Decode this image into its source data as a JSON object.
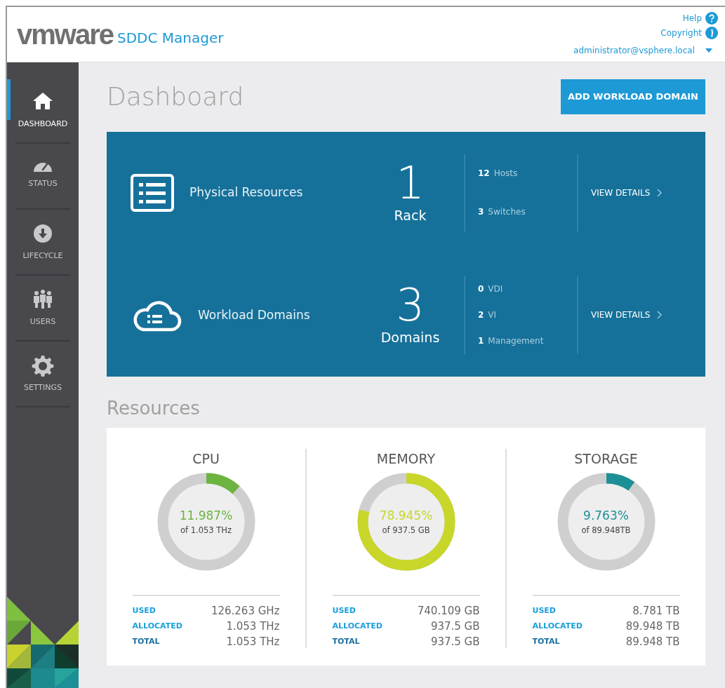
{
  "header": {
    "logo": "vmware",
    "product": "SDDC Manager",
    "links": [
      {
        "label": "Help",
        "kind": "help"
      },
      {
        "label": "Copyright",
        "kind": "info"
      }
    ],
    "user": "administrator@vsphere.local"
  },
  "sidebar": {
    "items": [
      {
        "label": "DASHBOARD",
        "kind": "home",
        "selected": true
      },
      {
        "label": "STATUS",
        "kind": "gauge",
        "selected": false
      },
      {
        "label": "LIFECYCLE",
        "kind": "download",
        "selected": false
      },
      {
        "label": "USERS",
        "kind": "users",
        "selected": false
      },
      {
        "label": "SETTINGS",
        "kind": "gear",
        "selected": false
      }
    ]
  },
  "page": {
    "title": "Dashboard",
    "action": "ADD WORKLOAD DOMAIN"
  },
  "summary": [
    {
      "kind": "list",
      "title": "Physical Resources",
      "count": "1",
      "unit": "Rack",
      "stats": [
        {
          "count": "12",
          "label": "Hosts"
        },
        {
          "count": "3",
          "label": "Switches"
        }
      ],
      "link": "VIEW DETAILS"
    },
    {
      "kind": "cloud",
      "title": "Workload Domains",
      "count": "3",
      "unit": "Domains",
      "stats": [
        {
          "count": "0",
          "label": "VDI"
        },
        {
          "count": "2",
          "label": "VI"
        },
        {
          "count": "1",
          "label": "Management"
        }
      ],
      "link": "VIEW DETAILS"
    }
  ],
  "resources": {
    "title": "Resources",
    "items": [
      {
        "name": "CPU",
        "percent": "11.987%",
        "of": "of 1.053 THz",
        "color": "#6db33f",
        "rows": [
          {
            "label": "USED",
            "value": "126.263 GHz"
          },
          {
            "label": "ALLOCATED",
            "value": "1.053 THz"
          },
          {
            "label": "TOTAL",
            "value": "1.053 THz"
          }
        ]
      },
      {
        "name": "MEMORY",
        "percent": "78.945%",
        "of": "of 937.5 GB",
        "color": "#c8d62a",
        "rows": [
          {
            "label": "USED",
            "value": "740.109 GB"
          },
          {
            "label": "ALLOCATED",
            "value": "937.5 GB"
          },
          {
            "label": "TOTAL",
            "value": "937.5 GB"
          }
        ]
      },
      {
        "name": "STORAGE",
        "percent": "9.763%",
        "of": "of 89.948TB",
        "color": "#1c9096",
        "rows": [
          {
            "label": "USED",
            "value": "8.781 TB"
          },
          {
            "label": "ALLOCATED",
            "value": "89.948 TB"
          },
          {
            "label": "TOTAL",
            "value": "89.948 TB"
          }
        ]
      }
    ]
  }
}
